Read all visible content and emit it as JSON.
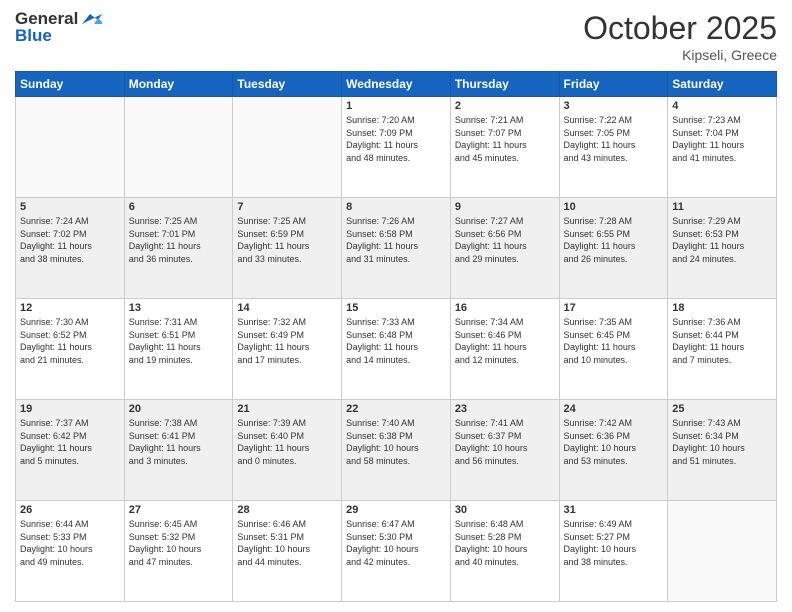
{
  "header": {
    "logo_line1": "General",
    "logo_line2": "Blue",
    "month": "October 2025",
    "location": "Kipseli, Greece"
  },
  "days_of_week": [
    "Sunday",
    "Monday",
    "Tuesday",
    "Wednesday",
    "Thursday",
    "Friday",
    "Saturday"
  ],
  "weeks": [
    [
      {
        "day": "",
        "info": ""
      },
      {
        "day": "",
        "info": ""
      },
      {
        "day": "",
        "info": ""
      },
      {
        "day": "1",
        "info": "Sunrise: 7:20 AM\nSunset: 7:09 PM\nDaylight: 11 hours\nand 48 minutes."
      },
      {
        "day": "2",
        "info": "Sunrise: 7:21 AM\nSunset: 7:07 PM\nDaylight: 11 hours\nand 45 minutes."
      },
      {
        "day": "3",
        "info": "Sunrise: 7:22 AM\nSunset: 7:05 PM\nDaylight: 11 hours\nand 43 minutes."
      },
      {
        "day": "4",
        "info": "Sunrise: 7:23 AM\nSunset: 7:04 PM\nDaylight: 11 hours\nand 41 minutes."
      }
    ],
    [
      {
        "day": "5",
        "info": "Sunrise: 7:24 AM\nSunset: 7:02 PM\nDaylight: 11 hours\nand 38 minutes."
      },
      {
        "day": "6",
        "info": "Sunrise: 7:25 AM\nSunset: 7:01 PM\nDaylight: 11 hours\nand 36 minutes."
      },
      {
        "day": "7",
        "info": "Sunrise: 7:25 AM\nSunset: 6:59 PM\nDaylight: 11 hours\nand 33 minutes."
      },
      {
        "day": "8",
        "info": "Sunrise: 7:26 AM\nSunset: 6:58 PM\nDaylight: 11 hours\nand 31 minutes."
      },
      {
        "day": "9",
        "info": "Sunrise: 7:27 AM\nSunset: 6:56 PM\nDaylight: 11 hours\nand 29 minutes."
      },
      {
        "day": "10",
        "info": "Sunrise: 7:28 AM\nSunset: 6:55 PM\nDaylight: 11 hours\nand 26 minutes."
      },
      {
        "day": "11",
        "info": "Sunrise: 7:29 AM\nSunset: 6:53 PM\nDaylight: 11 hours\nand 24 minutes."
      }
    ],
    [
      {
        "day": "12",
        "info": "Sunrise: 7:30 AM\nSunset: 6:52 PM\nDaylight: 11 hours\nand 21 minutes."
      },
      {
        "day": "13",
        "info": "Sunrise: 7:31 AM\nSunset: 6:51 PM\nDaylight: 11 hours\nand 19 minutes."
      },
      {
        "day": "14",
        "info": "Sunrise: 7:32 AM\nSunset: 6:49 PM\nDaylight: 11 hours\nand 17 minutes."
      },
      {
        "day": "15",
        "info": "Sunrise: 7:33 AM\nSunset: 6:48 PM\nDaylight: 11 hours\nand 14 minutes."
      },
      {
        "day": "16",
        "info": "Sunrise: 7:34 AM\nSunset: 6:46 PM\nDaylight: 11 hours\nand 12 minutes."
      },
      {
        "day": "17",
        "info": "Sunrise: 7:35 AM\nSunset: 6:45 PM\nDaylight: 11 hours\nand 10 minutes."
      },
      {
        "day": "18",
        "info": "Sunrise: 7:36 AM\nSunset: 6:44 PM\nDaylight: 11 hours\nand 7 minutes."
      }
    ],
    [
      {
        "day": "19",
        "info": "Sunrise: 7:37 AM\nSunset: 6:42 PM\nDaylight: 11 hours\nand 5 minutes."
      },
      {
        "day": "20",
        "info": "Sunrise: 7:38 AM\nSunset: 6:41 PM\nDaylight: 11 hours\nand 3 minutes."
      },
      {
        "day": "21",
        "info": "Sunrise: 7:39 AM\nSunset: 6:40 PM\nDaylight: 11 hours\nand 0 minutes."
      },
      {
        "day": "22",
        "info": "Sunrise: 7:40 AM\nSunset: 6:38 PM\nDaylight: 10 hours\nand 58 minutes."
      },
      {
        "day": "23",
        "info": "Sunrise: 7:41 AM\nSunset: 6:37 PM\nDaylight: 10 hours\nand 56 minutes."
      },
      {
        "day": "24",
        "info": "Sunrise: 7:42 AM\nSunset: 6:36 PM\nDaylight: 10 hours\nand 53 minutes."
      },
      {
        "day": "25",
        "info": "Sunrise: 7:43 AM\nSunset: 6:34 PM\nDaylight: 10 hours\nand 51 minutes."
      }
    ],
    [
      {
        "day": "26",
        "info": "Sunrise: 6:44 AM\nSunset: 5:33 PM\nDaylight: 10 hours\nand 49 minutes."
      },
      {
        "day": "27",
        "info": "Sunrise: 6:45 AM\nSunset: 5:32 PM\nDaylight: 10 hours\nand 47 minutes."
      },
      {
        "day": "28",
        "info": "Sunrise: 6:46 AM\nSunset: 5:31 PM\nDaylight: 10 hours\nand 44 minutes."
      },
      {
        "day": "29",
        "info": "Sunrise: 6:47 AM\nSunset: 5:30 PM\nDaylight: 10 hours\nand 42 minutes."
      },
      {
        "day": "30",
        "info": "Sunrise: 6:48 AM\nSunset: 5:28 PM\nDaylight: 10 hours\nand 40 minutes."
      },
      {
        "day": "31",
        "info": "Sunrise: 6:49 AM\nSunset: 5:27 PM\nDaylight: 10 hours\nand 38 minutes."
      },
      {
        "day": "",
        "info": ""
      }
    ]
  ]
}
